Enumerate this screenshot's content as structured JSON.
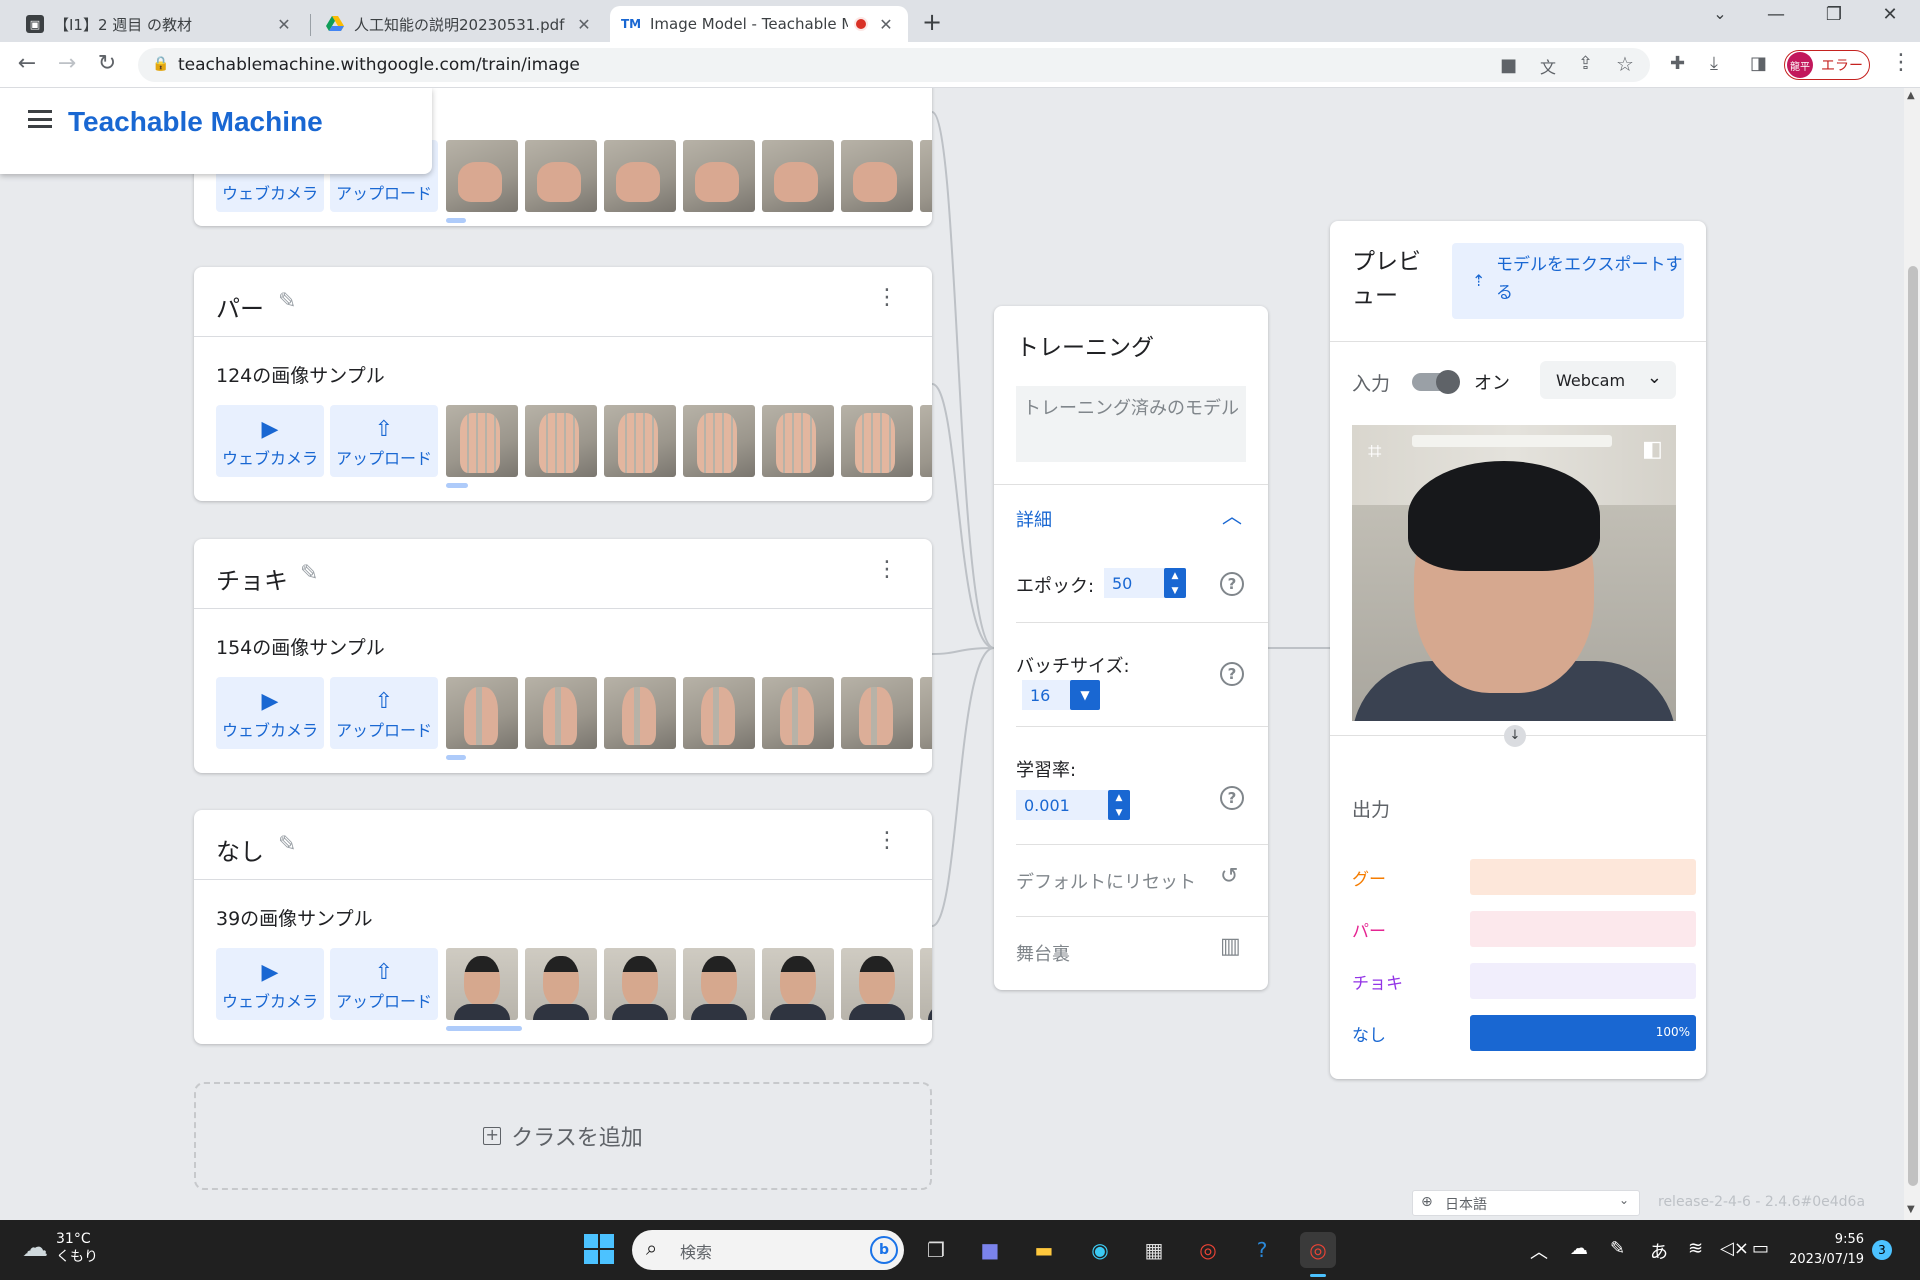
{
  "browser": {
    "tabs": [
      {
        "title": "【I1】2 週目 の教材",
        "favicon": "classroom-icon"
      },
      {
        "title": "人工知能の説明20230531.pdf - G",
        "favicon": "drive-icon"
      },
      {
        "title": "Image Model - Teachable M",
        "favicon": "teachable-machine-icon",
        "recording": true
      }
    ],
    "url": "teachablemachine.withgoogle.com/train/image",
    "profile_initials": "龍平",
    "profile_status": "エラー"
  },
  "app": {
    "title": "Teachable Machine"
  },
  "classes": [
    {
      "name": "",
      "samples": "",
      "webcam_label": "ウェブカメラ",
      "upload_label": "アップロード",
      "thumb_type": "fist"
    },
    {
      "name": "パー",
      "samples": "124の画像サンプル",
      "webcam_label": "ウェブカメラ",
      "upload_label": "アップロード",
      "thumb_type": "palm"
    },
    {
      "name": "チョキ",
      "samples": "154の画像サンプル",
      "webcam_label": "ウェブカメラ",
      "upload_label": "アップロード",
      "thumb_type": "peace"
    },
    {
      "name": "なし",
      "samples": "39の画像サンプル",
      "webcam_label": "ウェブカメラ",
      "upload_label": "アップロード",
      "thumb_type": "face"
    }
  ],
  "add_class_label": "クラスを追加",
  "training": {
    "title": "トレーニング",
    "trained_button": "トレーニング済みのモデル",
    "details_label": "詳細",
    "epochs_label": "エポック:",
    "epochs_value": "50",
    "batch_label": "バッチサイズ:",
    "batch_value": "16",
    "lr_label": "学習率:",
    "lr_value": "0.001",
    "reset_label": "デフォルトにリセット",
    "backstage_label": "舞台裏"
  },
  "preview": {
    "title": "プレビュー",
    "export_label": "モデルをエクスポートする",
    "input_label": "入力",
    "toggle_state": "オン",
    "source_select": "Webcam",
    "output_label": "出力",
    "outputs": [
      {
        "name": "グー",
        "value": 0,
        "color": "#f57c00",
        "bg": "#fde7da",
        "fill": "#f57c00"
      },
      {
        "name": "パー",
        "value": 0,
        "color": "#e52592",
        "bg": "#fce8ec",
        "fill": "#e52592"
      },
      {
        "name": "チョキ",
        "value": 0,
        "color": "#9334e6",
        "bg": "#f1eefc",
        "fill": "#9334e6"
      },
      {
        "name": "なし",
        "value": 1.0,
        "color": "#1967d2",
        "bg": "#d2e3fc",
        "fill": "#1967d2",
        "label": "100%"
      }
    ]
  },
  "footer": {
    "language": "日本語",
    "release": "release-2-4-6 - 2.4.6#0e4d6a"
  },
  "taskbar": {
    "temperature": "31°C",
    "weather": "くもり",
    "search_placeholder": "検索",
    "time": "9:56",
    "date": "2023/07/19",
    "notifications": "3",
    "ime": "あ"
  }
}
